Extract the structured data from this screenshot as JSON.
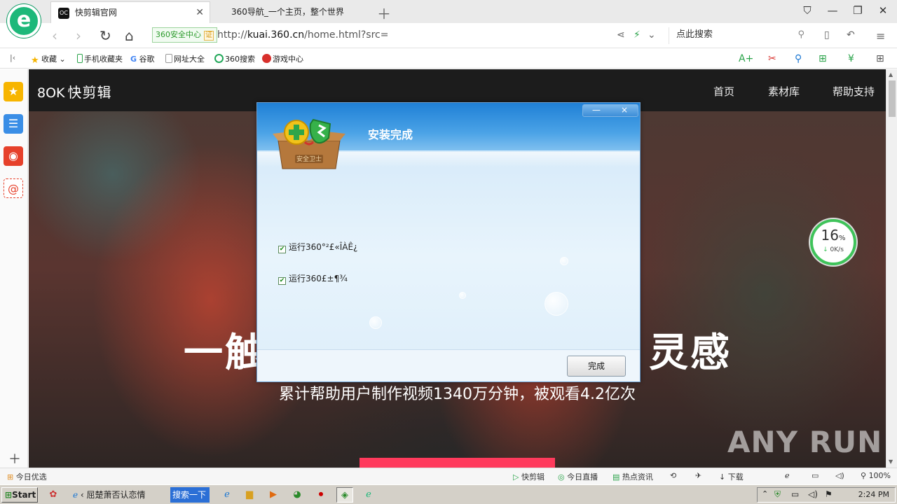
{
  "browser": {
    "tabs": [
      {
        "favicon": "OC",
        "label": "快剪辑官网",
        "active": true
      },
      {
        "label": "360导航_一个主页，整个世界",
        "active": false
      }
    ],
    "security_badge": "360安全中心",
    "cert_mark": "证",
    "url_prefix": "http://",
    "url_host": "kuai.360.cn",
    "url_path": "/home.html?src=",
    "search_placeholder": "点此搜索"
  },
  "bookmarks": [
    {
      "label": "收藏",
      "icon": "star-icon",
      "color": "#f5b400"
    },
    {
      "label": "手机收藏夹",
      "icon": "phone-icon",
      "color": "#2aa34a"
    },
    {
      "label": "谷歌",
      "icon": "google-icon",
      "color": "#4285f4"
    },
    {
      "label": "网址大全",
      "icon": "page-icon",
      "color": "#999999"
    },
    {
      "label": "360搜索",
      "icon": "search360-icon",
      "color": "#23a85a"
    },
    {
      "label": "游戏中心",
      "icon": "game-icon",
      "color": "#d8302c"
    }
  ],
  "site": {
    "logo_mark": "8OK",
    "logo_name": "快剪辑",
    "nav": [
      "首页",
      "素材库",
      "帮助支持"
    ],
    "hero_left": "一触",
    "hero_right": "灵感",
    "hero_sub": "累计帮助用户制作视频1340万分钟，被观看4.2亿次"
  },
  "speed_widget": {
    "percent": "16",
    "percent_unit": "%",
    "rate": "0K/s"
  },
  "watermark": "ANY RUN",
  "dialog": {
    "title": "安装完成",
    "box_label": "安全卫士",
    "minimize": "—",
    "close": "×",
    "options": [
      {
        "label": "运行360°²£«ÎÀÊ¿",
        "checked": true
      },
      {
        "label": "运行360£±¶¾",
        "checked": true
      }
    ],
    "finish_button": "完成"
  },
  "statusbar": {
    "left": "今日优选",
    "items": [
      "快剪辑",
      "今日直播",
      "热点资讯",
      "下载"
    ],
    "zoom": "100%"
  },
  "taskbar": {
    "start": "Start",
    "task": "屈楚萧否认恋情",
    "search": "搜索一下",
    "clock": "2:24 PM"
  },
  "colors": {
    "accent": "#1db87a",
    "dialog_header": "#1f80d6",
    "pink": "#ff3a5c"
  }
}
